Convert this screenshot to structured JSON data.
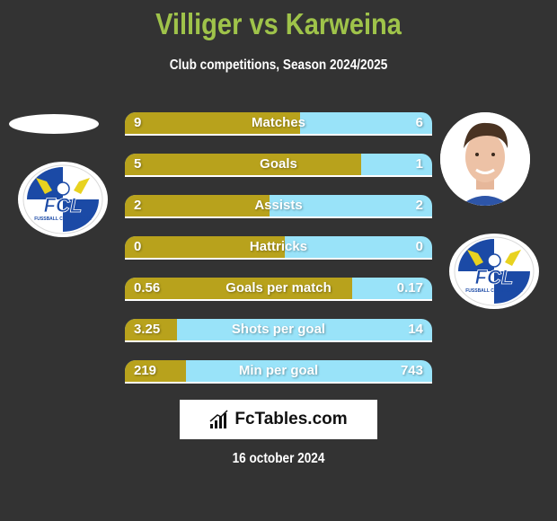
{
  "header": {
    "title": "Villiger vs Karweina",
    "subtitle": "Club competitions, Season 2024/2025"
  },
  "players": {
    "left": {
      "name": "Villiger",
      "club_badge": "fc-luzern-badge-icon"
    },
    "right": {
      "name": "Karweina",
      "club_badge": "fc-luzern-badge-icon",
      "photo": "player-photo"
    }
  },
  "colors": {
    "left": "#b8a21c",
    "right": "#99e3f9",
    "title": "#9fc34a",
    "background": "#333333"
  },
  "stats": [
    {
      "label": "Matches",
      "left": "9",
      "right": "6",
      "left_fill": 0.57
    },
    {
      "label": "Goals",
      "left": "5",
      "right": "1",
      "left_fill": 0.77
    },
    {
      "label": "Assists",
      "left": "2",
      "right": "2",
      "left_fill": 0.47
    },
    {
      "label": "Hattricks",
      "left": "0",
      "right": "0",
      "left_fill": 0.52
    },
    {
      "label": "Goals per match",
      "left": "0.56",
      "right": "0.17",
      "left_fill": 0.74
    },
    {
      "label": "Shots per goal",
      "left": "3.25",
      "right": "14",
      "left_fill": 0.17
    },
    {
      "label": "Min per goal",
      "left": "219",
      "right": "743",
      "left_fill": 0.2
    }
  ],
  "brand": {
    "name": "FcTables.com",
    "icon": "bar-chart-icon"
  },
  "footer": {
    "date": "16 october 2024"
  },
  "badge": {
    "text": "FCL",
    "subtext": "FUSSBALL CLUB LUZERN"
  }
}
